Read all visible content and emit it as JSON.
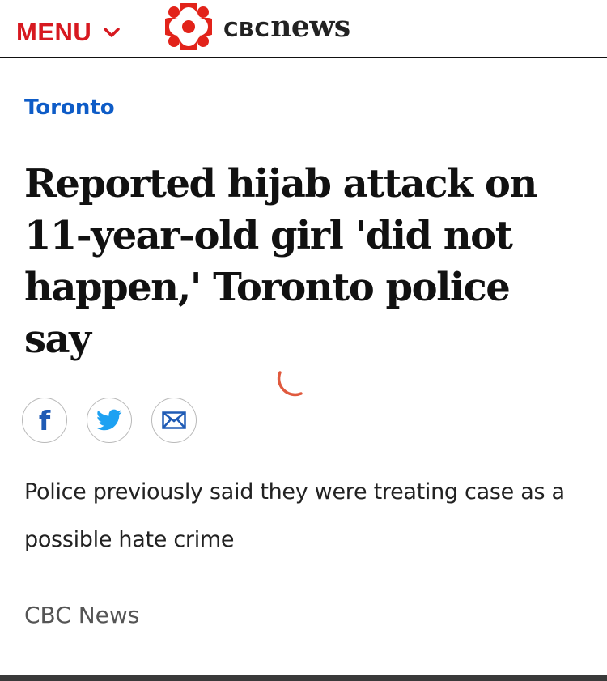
{
  "header": {
    "menu_label": "MENU",
    "logo_cbc": "CBC",
    "logo_news": "news",
    "brand_color": "#d71920"
  },
  "article": {
    "section": "Toronto",
    "section_color": "#0e5cc7",
    "headline": "Reported hijab attack on 11-year-old girl 'did not happen,' Toronto police say",
    "deck": "Police previously said they were treating case as a possible hate crime",
    "byline": "CBC News"
  },
  "share": {
    "icons": [
      "facebook-icon",
      "twitter-icon",
      "email-icon"
    ],
    "facebook_letter": "f"
  }
}
